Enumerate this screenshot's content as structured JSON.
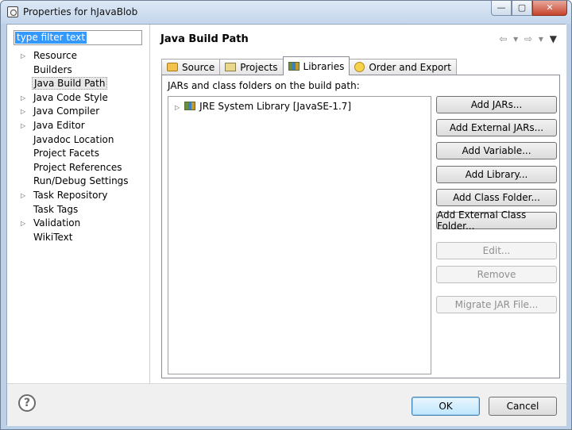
{
  "window": {
    "title": "Properties for hJavaBlob",
    "min_symbol": "—",
    "max_symbol": "▢",
    "close_symbol": "✕"
  },
  "sidebar": {
    "filter_value": "type filter text",
    "items": [
      {
        "label": "Resource",
        "arrow": "▷"
      },
      {
        "label": "Builders",
        "arrow": ""
      },
      {
        "label": "Java Build Path",
        "arrow": ""
      },
      {
        "label": "Java Code Style",
        "arrow": "▷"
      },
      {
        "label": "Java Compiler",
        "arrow": "▷"
      },
      {
        "label": "Java Editor",
        "arrow": "▷"
      },
      {
        "label": "Javadoc Location",
        "arrow": ""
      },
      {
        "label": "Project Facets",
        "arrow": ""
      },
      {
        "label": "Project References",
        "arrow": ""
      },
      {
        "label": "Run/Debug Settings",
        "arrow": ""
      },
      {
        "label": "Task Repository",
        "arrow": "▷"
      },
      {
        "label": "Task Tags",
        "arrow": ""
      },
      {
        "label": "Validation",
        "arrow": "▷"
      },
      {
        "label": "WikiText",
        "arrow": ""
      }
    ],
    "selected_item": "Java Build Path"
  },
  "main": {
    "title": "Java Build Path",
    "nav": {
      "back": "⇦",
      "back_menu": "▾",
      "forward": "⇨",
      "forward_menu": "▾",
      "view_menu": "▼"
    },
    "tabs": [
      {
        "label": "Source",
        "icon": "source-folder-icon"
      },
      {
        "label": "Projects",
        "icon": "projects-icon"
      },
      {
        "label": "Libraries",
        "icon": "libraries-icon"
      },
      {
        "label": "Order and Export",
        "icon": "order-export-icon"
      }
    ],
    "active_tab": "Libraries",
    "panel_label": "JARs and class folders on the build path:",
    "entries": [
      {
        "arrow": "▷",
        "label": "JRE System Library [JavaSE-1.7]",
        "icon": "library-icon"
      }
    ],
    "buttons": [
      {
        "label": "Add JARs...",
        "enabled": true
      },
      {
        "label": "Add External JARs...",
        "enabled": true
      },
      {
        "label": "Add Variable...",
        "enabled": true
      },
      {
        "label": "Add Library...",
        "enabled": true
      },
      {
        "label": "Add Class Folder...",
        "enabled": true
      },
      {
        "label": "Add External Class Folder...",
        "enabled": true
      },
      {
        "label": "Edit...",
        "enabled": false
      },
      {
        "label": "Remove",
        "enabled": false
      },
      {
        "label": "Migrate JAR File...",
        "enabled": false
      }
    ]
  },
  "footer": {
    "help_symbol": "?",
    "ok_label": "OK",
    "cancel_label": "Cancel"
  }
}
